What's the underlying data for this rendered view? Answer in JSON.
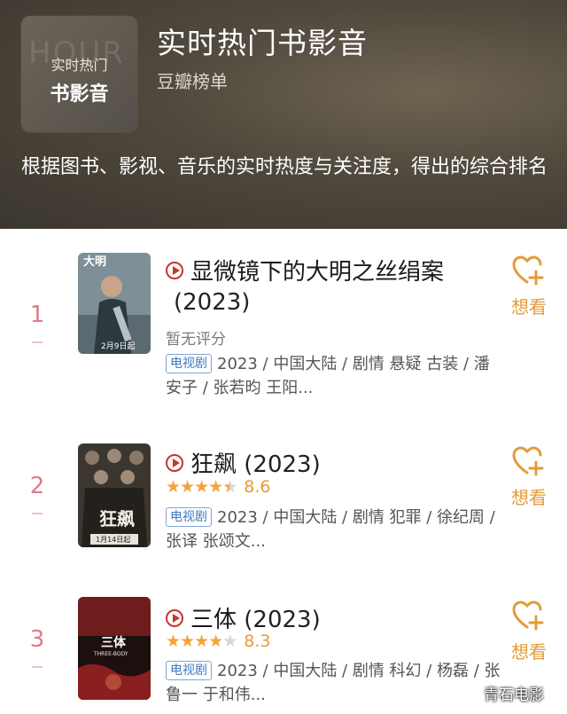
{
  "header": {
    "cover": {
      "watermark": "HOUR",
      "line1": "实时热门",
      "line2": "书影音"
    },
    "title": "实时热门书影音",
    "subtitle": "豆瓣榜单",
    "description": "根据图书、影视、音乐的实时热度与关注度，得出的综合排名"
  },
  "items": [
    {
      "rank": "1",
      "poster": {
        "title": "大明",
        "date": "2月9日起"
      },
      "title": "显微镜下的大明之丝绢案",
      "year": "(2023)",
      "rating_text": "暂无评分",
      "tag": "电视剧",
      "meta_line1": "2023 / 中国大陆 / 剧情 悬疑 古装 / 潘",
      "meta_line2": "安子 / 张若昀 王阳...",
      "want_label": "想看"
    },
    {
      "rank": "2",
      "poster": {
        "title": "狂飙",
        "date": "1月14日起"
      },
      "title": "狂飙",
      "year": "(2023)",
      "stars": 4.5,
      "score": "8.6",
      "tag": "电视剧",
      "meta_line1": "2023 / 中国大陆 / 剧情 犯罪 / 徐纪周 /",
      "meta_line2": "张译 张颂文...",
      "want_label": "想看"
    },
    {
      "rank": "3",
      "poster": {
        "title": "三体",
        "sub": "THREE-BODY"
      },
      "title": "三体",
      "year": "(2023)",
      "stars": 4,
      "score": "8.3",
      "tag": "电视剧",
      "meta_line1": "2023 / 中国大陆 / 剧情 科幻 / 杨磊 / 张",
      "meta_line2": "鲁一 于和伟...",
      "want_label": "想看"
    }
  ],
  "watermark": "青石电影",
  "colors": {
    "accent": "#e49b3a",
    "rank": "#e07a86",
    "tag": "#3f78be",
    "play": "#c9342c"
  }
}
